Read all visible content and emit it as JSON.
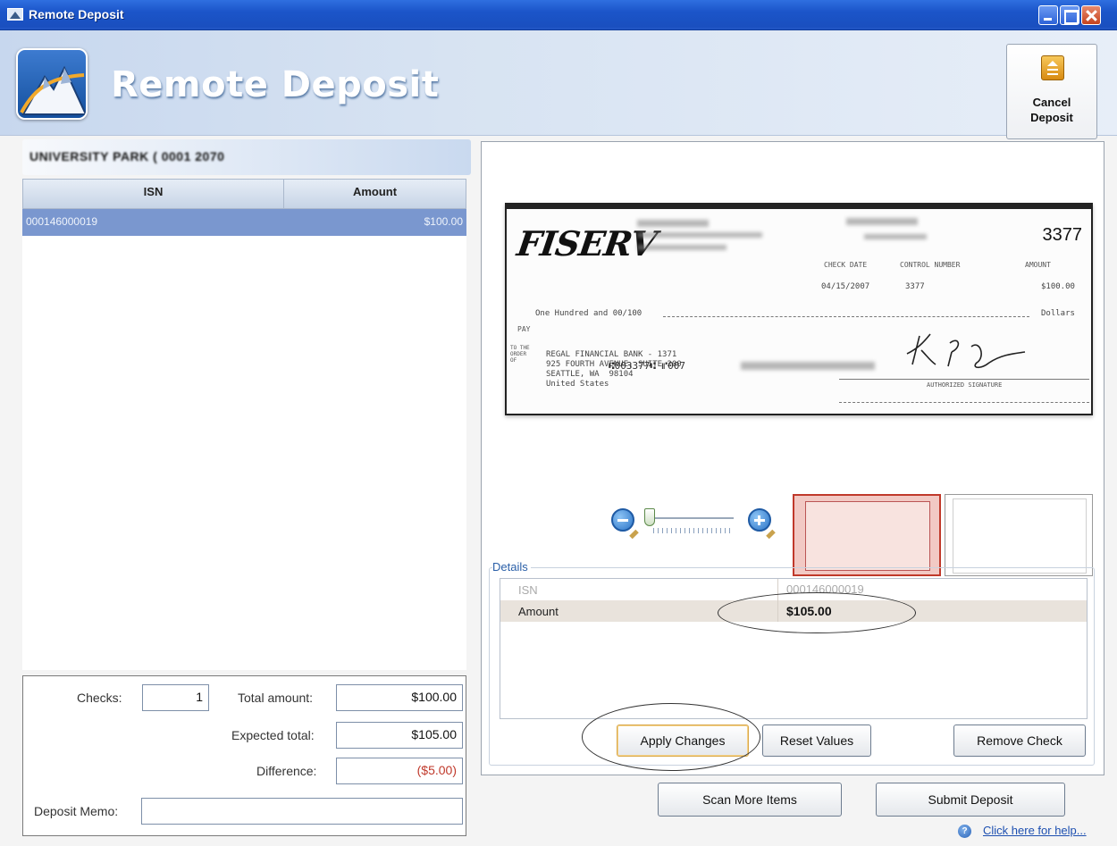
{
  "window": {
    "title": "Remote Deposit"
  },
  "header": {
    "title": "Remote Deposit",
    "cancel_label": "Cancel\nDeposit"
  },
  "account": {
    "name": "UNIVERSITY PARK ( 0001 2070"
  },
  "grid": {
    "columns": [
      "ISN",
      "Amount"
    ],
    "rows": [
      {
        "isn": "000146000019",
        "amount": "$100.00"
      }
    ]
  },
  "totals": {
    "checks_label": "Checks:",
    "checks_value": "1",
    "total_label": "Total amount:",
    "total_value": "$100.00",
    "expected_label": "Expected total:",
    "expected_value": "$105.00",
    "difference_label": "Difference:",
    "difference_value": "($5.00)",
    "memo_label": "Deposit Memo:",
    "memo_value": ""
  },
  "check_image": {
    "logo_text": "FISERV",
    "check_number": "3377",
    "check_date_label": "CHECK DATE",
    "control_label": "CONTROL NUMBER",
    "amount_label": "AMOUNT",
    "check_date": "04/15/2007",
    "control_number": "3377",
    "amount": "$100.00",
    "written_amount": "One Hundred and 00/100",
    "dollars_label": "Dollars",
    "pay_label": "PAY",
    "to_order_label": "TO THE\nORDER\nOF",
    "payee": "REGAL FINANCIAL BANK - 1371\n925 FOURTH AVENUE, SUITE 200\nSEATTLE, WA  98104\nUnited States",
    "signature_label": "AUTHORIZED SIGNATURE",
    "signature": "K.P.",
    "micr": "⑆003377⑆ ⑈007"
  },
  "details": {
    "legend": "Details",
    "rows": [
      {
        "label": "ISN",
        "value": "000146000019"
      },
      {
        "label": "Amount",
        "value": "$105.00"
      }
    ]
  },
  "buttons": {
    "apply": "Apply Changes",
    "reset": "Reset Values",
    "remove": "Remove Check",
    "scan_more": "Scan More Items",
    "submit": "Submit Deposit"
  },
  "help": {
    "link": "Click here for help..."
  },
  "icons": {
    "zoom_out": "zoom-out-icon",
    "zoom_in": "zoom-in-icon",
    "help": "help-icon",
    "cancel": "cancel-deposit-icon",
    "app": "mountain-logo-icon"
  },
  "colors": {
    "selected_row": "#7a97cf",
    "difference": "#c0392b",
    "details_legend": "#2a5fa8",
    "title_bar": "#1b55c9"
  }
}
